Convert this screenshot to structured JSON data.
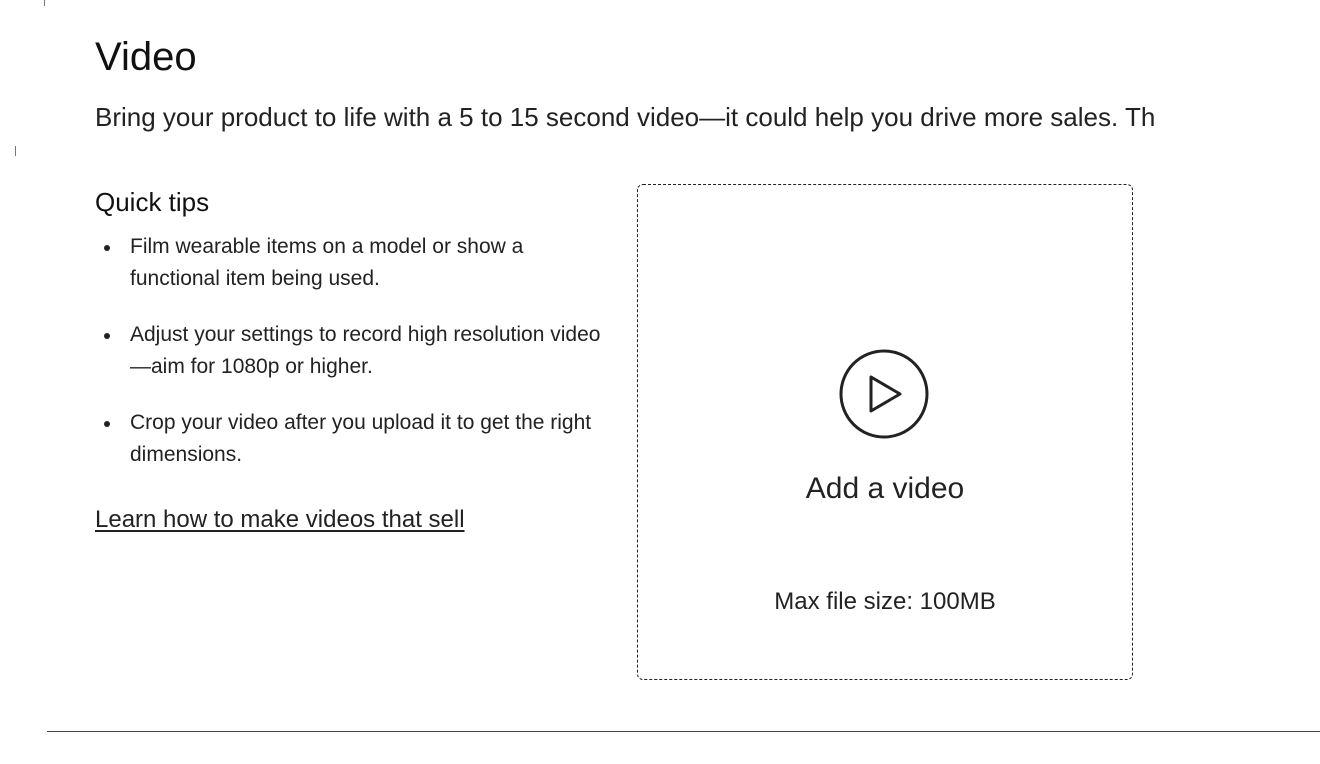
{
  "section": {
    "title": "Video",
    "description": "Bring your product to life with a 5 to 15 second video—it could help you drive more sales. Th"
  },
  "tips": {
    "heading": "Quick tips",
    "items": [
      "Film wearable items on a model or show a functional item being used.",
      "Adjust your settings to record high resolution video—aim for 1080p or higher.",
      "Crop your video after you upload it to get the right dimensions."
    ],
    "link_label": "Learn how to make videos that sell"
  },
  "upload": {
    "label": "Add a video",
    "max_size": "Max file size: 100MB",
    "icon": "play-circle-icon"
  },
  "colors": {
    "text": "#222222",
    "border": "#222222",
    "background": "#ffffff"
  }
}
